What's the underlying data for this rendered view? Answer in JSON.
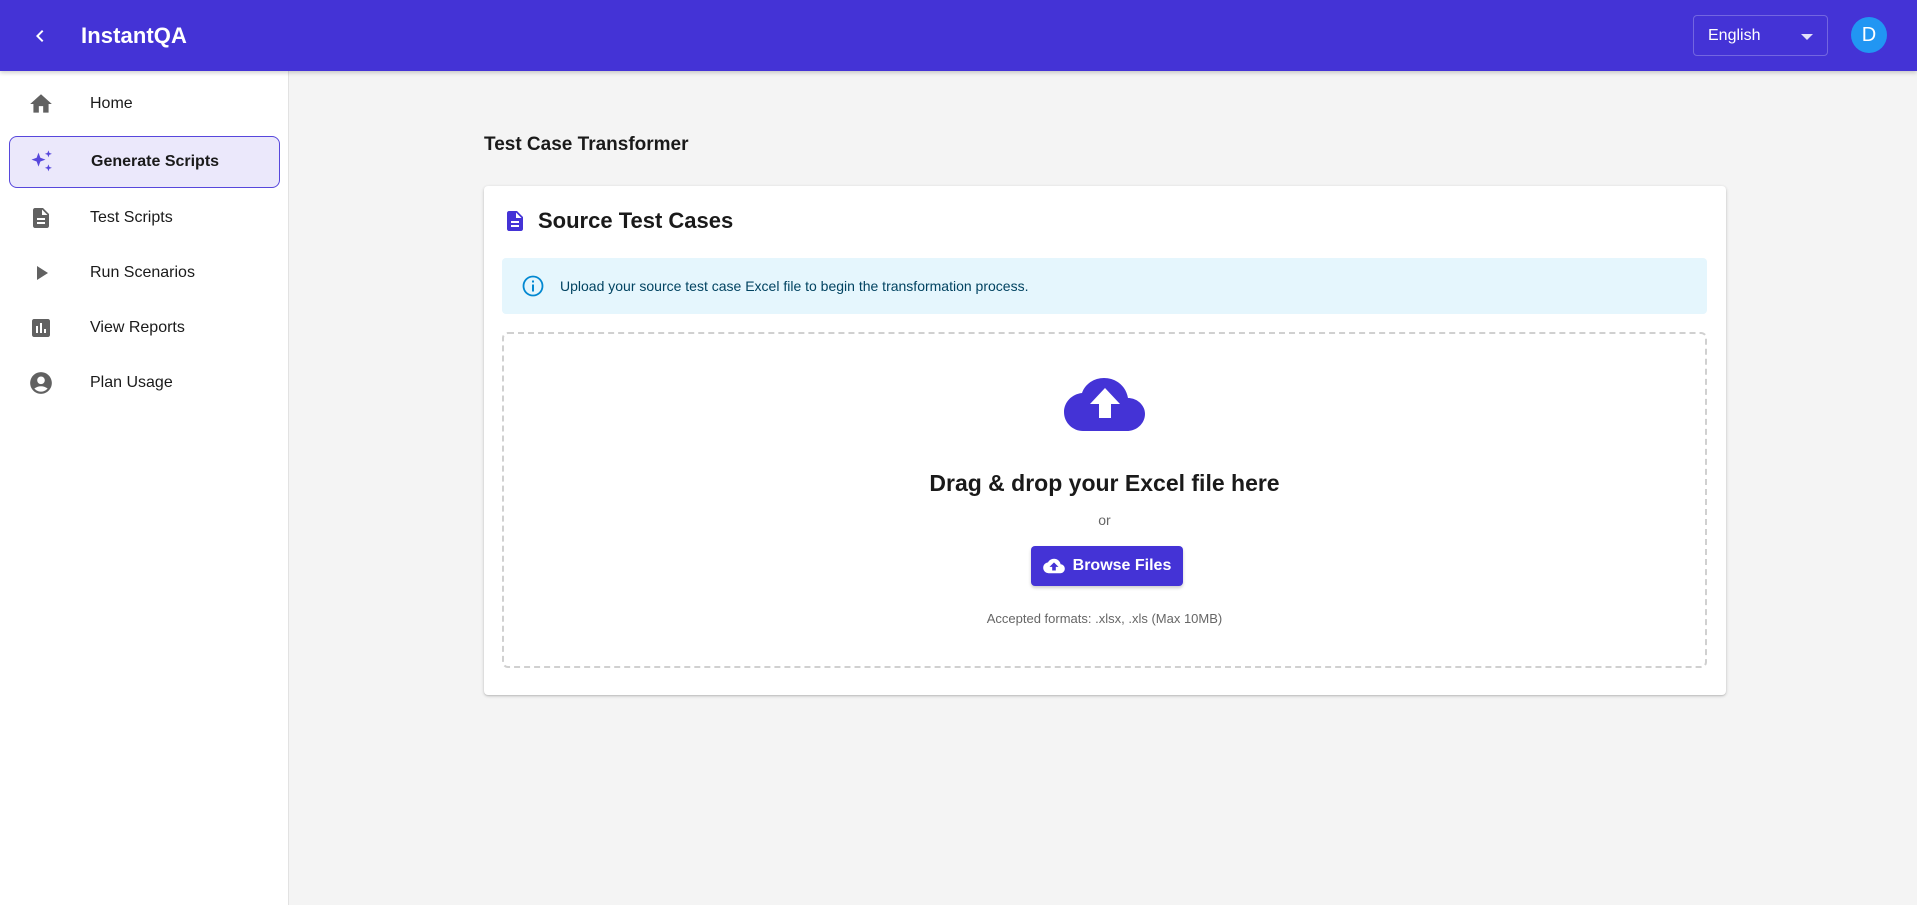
{
  "app": {
    "title": "InstantQA"
  },
  "header": {
    "language": "English",
    "avatar_initial": "D"
  },
  "sidebar": {
    "items": [
      {
        "label": "Home",
        "icon": "home-icon",
        "active": false
      },
      {
        "label": "Generate Scripts",
        "icon": "sparkles-icon",
        "active": true
      },
      {
        "label": "Test Scripts",
        "icon": "document-icon",
        "active": false
      },
      {
        "label": "Run Scenarios",
        "icon": "play-icon",
        "active": false
      },
      {
        "label": "View Reports",
        "icon": "bar-chart-icon",
        "active": false
      },
      {
        "label": "Plan Usage",
        "icon": "account-circle-icon",
        "active": false
      }
    ]
  },
  "main": {
    "page_title": "Test Case Transformer",
    "card": {
      "title": "Source Test Cases",
      "info": "Upload your source test case Excel file to begin the transformation process.",
      "dropzone": {
        "title": "Drag & drop your Excel file here",
        "or": "or",
        "browse_label": "Browse Files",
        "hint": "Accepted formats: .xlsx, .xls (Max 10MB)"
      }
    }
  },
  "colors": {
    "primary": "#4433d6",
    "active_bg": "#ebe8fb",
    "info_bg": "#e5f6fd",
    "info_icon": "#0288d1",
    "avatar": "#2196f3"
  }
}
